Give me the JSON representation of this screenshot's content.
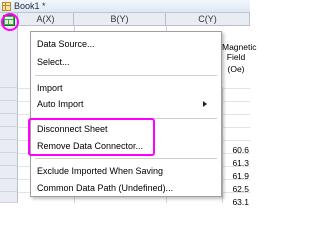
{
  "window": {
    "title": "Book1 *",
    "icon": "origin-book-icon"
  },
  "sheet": {
    "columns": [
      "A(X)",
      "B(Y)",
      "C(Y)"
    ],
    "meta": {
      "name_line1": "Magnetic",
      "name_line2": "Field",
      "unit": "(Oe)"
    },
    "values": [
      "60.6",
      "61.3",
      "61.9",
      "62.5",
      "63.1"
    ],
    "connector_icon": "data-connector-icon"
  },
  "context_menu": {
    "items": {
      "data_source": "Data Source...",
      "select": "Select...",
      "import": "Import",
      "auto_import": "Auto Import",
      "disconnect_sheet": "Disconnect Sheet",
      "remove_connector": "Remove Data Connector...",
      "exclude_imported": "Exclude Imported When Saving",
      "common_path": "Common Data Path (Undefined)..."
    },
    "highlight_color": "#ff00ff"
  }
}
